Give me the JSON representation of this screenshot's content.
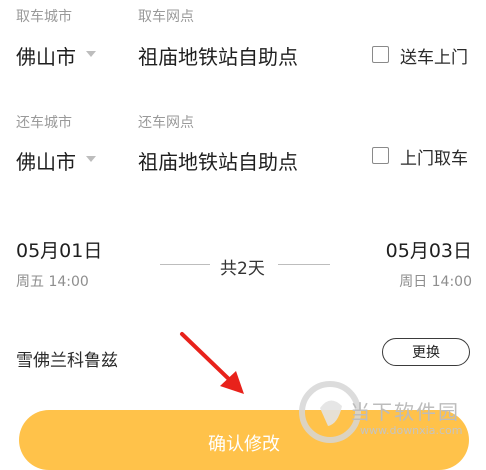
{
  "pickup": {
    "city_label": "取车城市",
    "point_label": "取车网点",
    "city": "佛山市",
    "station": "祖庙地铁站自助点",
    "option_label": "送车上门"
  },
  "return": {
    "city_label": "还车城市",
    "point_label": "还车网点",
    "city": "佛山市",
    "station": "祖庙地铁站自助点",
    "option_label": "上门取车"
  },
  "schedule": {
    "start_date": "05月01日",
    "start_time": "周五 14:00",
    "duration": "共2天",
    "end_date": "05月03日",
    "end_time": "周日 14:00"
  },
  "vehicle": {
    "name": "雪佛兰科鲁兹",
    "change_label": "更换"
  },
  "confirm_label": "确认修改",
  "watermark": {
    "title": "当下软件园",
    "url": "www.downxia.com"
  },
  "colors": {
    "accent": "#ffc24a",
    "arrow": "#e8221b"
  }
}
